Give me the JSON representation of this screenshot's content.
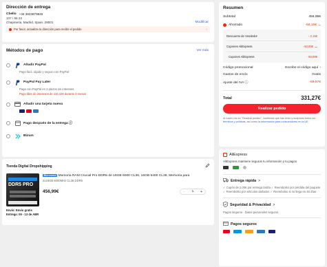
{
  "address": {
    "title": "Dirección de entrega",
    "name": "Chello",
    "phone": "+34 3923879845",
    "line1": "137 / 56 23",
    "line2": "Chapineria, Madrid, Spain, 28001",
    "modify": "Modificar",
    "warning": "Por favor, actualiza tu dirección para recibir el pedido"
  },
  "payment": {
    "title": "Métodos de pago",
    "more": "Ver más",
    "methods": [
      {
        "label": "Añadir PayPal",
        "desc": "Pago fácil, rápido y seguro con PayPal",
        "icon": "paypal-icon"
      },
      {
        "label": "PayPal Pay Later",
        "desc": "Paga con PayPal en 3 plazos sin intereses",
        "promo": "Pago libre de intereses de 110,42€ durante 3 meses",
        "icon": "paypal-icon"
      },
      {
        "label": "Añadir una tarjeta nueva",
        "icon": "card-icon"
      },
      {
        "label": "Pago después de la entrega ⓘ",
        "icon": "calendar-icon"
      },
      {
        "label": "Bizum",
        "icon": "bizum-icon"
      }
    ]
  },
  "store": {
    "name": "Tienda Digital Dropshipping",
    "badge": "Bienvenid",
    "product_title": "Memoria RAM Crucial Pro DDR5 de 16GB 6000 CL36, 16GB 6400 CL38, Memoria para",
    "variant": "2x16GB 6000MHz CL36,DDR5",
    "price": "456,99€",
    "qty": "1",
    "minus": "−",
    "plus": "+",
    "shipping1": "Envío: Envío gratis",
    "shipping2": "Entrega: 05 - 13 de ABR",
    "box_text": "DDR5 PRO"
  },
  "summary": {
    "title": "Resumen",
    "subtotal_label": "Subtotal",
    "subtotal": "456,99€",
    "saved_label": "Ahorrado",
    "saved": "-56,15€",
    "seller_discount_label": "Descuento de Vendedor",
    "seller_discount": "- 2,15€",
    "coupons_label": "Cupones AliExpress",
    "coupons": "- 50,00€",
    "coupons2_label": "Cupones AliExpress",
    "coupons2": "- 50,00€",
    "promo_label": "Código promocional",
    "promo_value": "Escribe el código aquí",
    "shipping_label": "Gastos de envío",
    "shipping": "Gratis",
    "vat_label": "Ajuste del IVA ⓘ",
    "vat": "-69,57€",
    "total_label": "Total",
    "total": "331,27€",
    "button": "Realizar pedido",
    "legal_pre": "Al hacer clic en \"Realizar pedido\", confirmas que has leído y aceptado todos los ",
    "legal_link1": "términos y políticas",
    "legal_mid": ", así como la ",
    "legal_link2": "información para consumidores en la UE",
    "legal_end": "."
  },
  "trust": {
    "brand": "AliExpress",
    "desc": "AliExpress mantiene seguros tu información y tu pagos",
    "fast_title": "Entrega rápida",
    "fast_desc": "✓ Cupón de 2,00€ por entrega tardía ✓ Reembolso por pérdida del paquete ✓ Reembolso por artículos dañados ✓ Reembolso si no llega en 45 días",
    "security_title": "Seguridad & Privacidad",
    "security_desc": "Pagos seguros · Datos personales seguros",
    "secure_pay_title": "Pagos seguros",
    "chevron": ">"
  },
  "colors": {
    "accent": "#e62e04",
    "button": "#f5222d",
    "link": "#2f62d6"
  }
}
